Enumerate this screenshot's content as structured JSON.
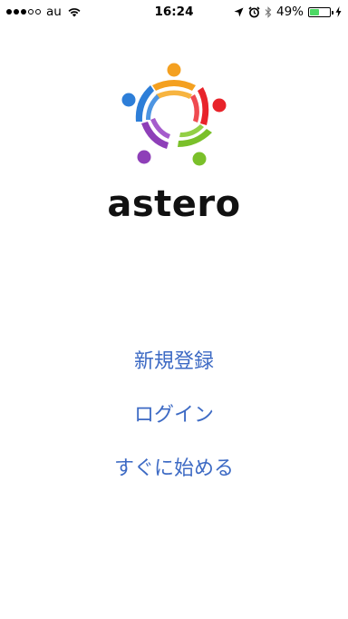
{
  "status_bar": {
    "signal_dots_filled": 3,
    "signal_dots_total": 5,
    "carrier": "au",
    "time": "16:24",
    "battery_percent": "49%",
    "battery_level": 0.49,
    "icons": [
      "wifi-icon",
      "location-arrow-icon",
      "alarm-icon",
      "bluetooth-icon",
      "battery-icon",
      "charging-bolt-icon"
    ],
    "battery_color": "#4cd964"
  },
  "logo": {
    "colors": [
      "#f4a020",
      "#e8232a",
      "#7ac02a",
      "#8e3fb8",
      "#2d7ed8"
    ]
  },
  "app": {
    "name": "astero"
  },
  "menu": {
    "register_label": "新規登録",
    "login_label": "ログイン",
    "start_label": "すぐに始める",
    "link_color": "#3d6ac4"
  }
}
